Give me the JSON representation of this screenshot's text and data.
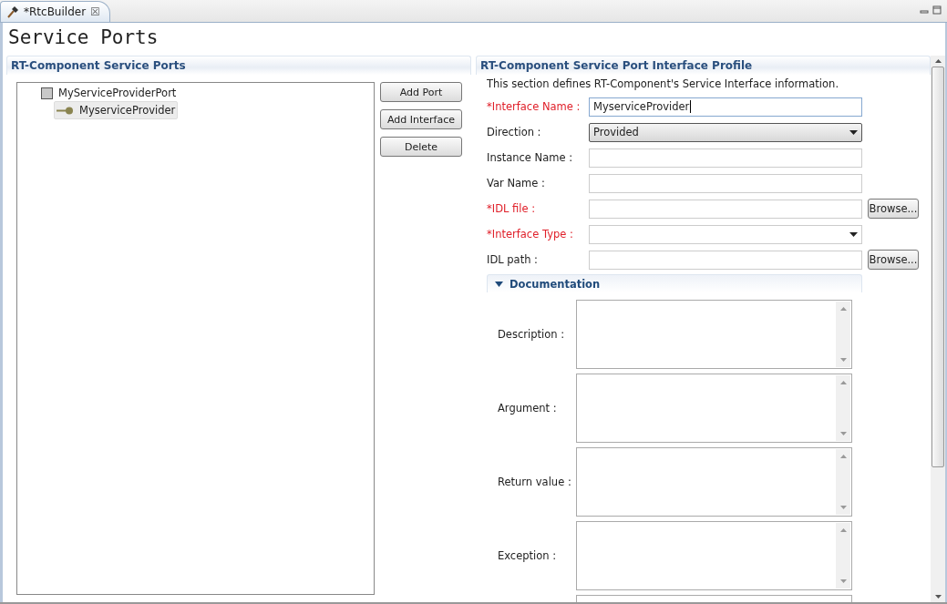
{
  "editor_tab": {
    "title": "*RtcBuilder",
    "close": "☒"
  },
  "page_title": "Service Ports",
  "ports_section": {
    "title": "RT-Component Service Ports",
    "tree": [
      {
        "label": "MyServiceProviderPort",
        "selected": false,
        "children": [
          {
            "label": "MyserviceProvider",
            "selected": true
          }
        ]
      }
    ],
    "buttons": [
      "Add Port",
      "Add Interface",
      "Delete"
    ]
  },
  "profile_section": {
    "title": "RT-Component Service Port Interface Profile",
    "description": "This section defines RT-Component's Service Interface information.",
    "fields": [
      {
        "kind": "text",
        "label": "*Interface Name :",
        "required": true,
        "value": "MyserviceProvider",
        "focused": true
      },
      {
        "kind": "combo",
        "label": "Direction :",
        "required": false,
        "value": "Provided"
      },
      {
        "kind": "text",
        "label": "Instance Name :",
        "required": false
      },
      {
        "kind": "text",
        "label": "Var Name :",
        "required": false
      },
      {
        "kind": "browse",
        "label": "*IDL file :",
        "required": true,
        "button": "Browse..."
      },
      {
        "kind": "editcombo",
        "label": "*Interface Type :",
        "required": true
      },
      {
        "kind": "browse",
        "label": "IDL path :",
        "required": false,
        "button": "Browse..."
      }
    ],
    "documentation": {
      "title": "Documentation",
      "expanded": true,
      "areas": [
        {
          "label": "Description :"
        },
        {
          "label": "Argument :"
        },
        {
          "label": "Return value :"
        },
        {
          "label": "Exception :"
        }
      ]
    }
  }
}
